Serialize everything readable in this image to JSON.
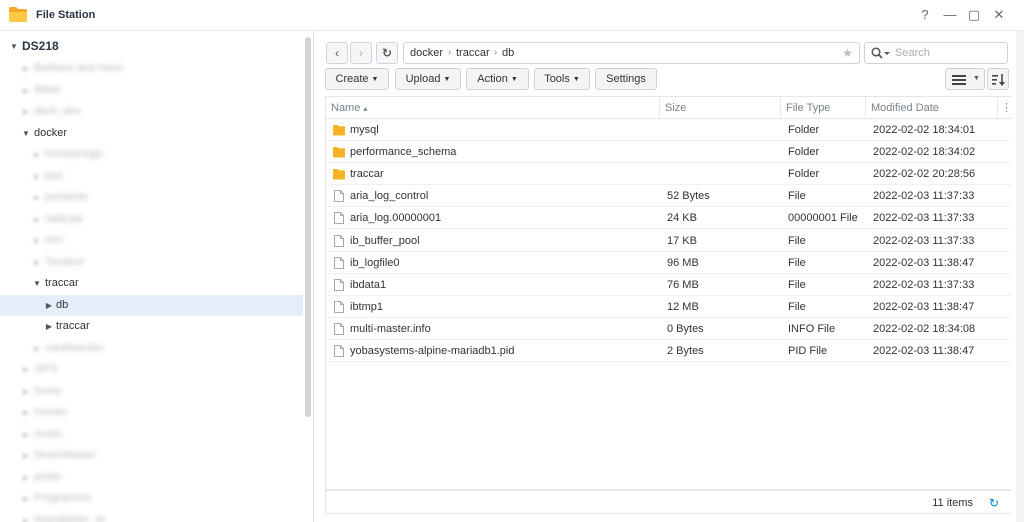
{
  "window": {
    "title": "File Station",
    "help_glyph": "?",
    "minimize_glyph": "—",
    "maximize_glyph": "▢",
    "close_glyph": "✕"
  },
  "tree": {
    "root": "DS218",
    "items": [
      {
        "label": "Barbara and Hans",
        "level": 1,
        "expanded": false,
        "blurred": true
      },
      {
        "label": "Bilder",
        "level": 1,
        "expanded": false,
        "blurred": true
      },
      {
        "label": "deck_dev",
        "level": 1,
        "expanded": false,
        "blurred": true
      },
      {
        "label": "docker",
        "level": 1,
        "expanded": true,
        "blurred": false
      },
      {
        "label": "homebridge",
        "level": 2,
        "expanded": false,
        "blurred": true
      },
      {
        "label": "test",
        "level": 2,
        "expanded": false,
        "blurred": true
      },
      {
        "label": "portainer",
        "level": 2,
        "expanded": false,
        "blurred": true
      },
      {
        "label": "radicale",
        "level": 2,
        "expanded": false,
        "blurred": true
      },
      {
        "label": "cert",
        "level": 2,
        "expanded": false,
        "blurred": true
      },
      {
        "label": "Tandoor",
        "level": 2,
        "expanded": false,
        "blurred": true
      },
      {
        "label": "traccar",
        "level": 2,
        "expanded": true,
        "blurred": false
      },
      {
        "label": "db",
        "level": 3,
        "expanded": false,
        "blurred": false,
        "selected": true
      },
      {
        "label": "traccar",
        "level": 3,
        "expanded": false,
        "blurred": false
      },
      {
        "label": "vaultwarden",
        "level": 2,
        "expanded": false,
        "blurred": true
      },
      {
        "label": "GPS",
        "level": 1,
        "expanded": false,
        "blurred": true
      },
      {
        "label": "home",
        "level": 1,
        "expanded": false,
        "blurred": true
      },
      {
        "label": "homes",
        "level": 1,
        "expanded": false,
        "blurred": true
      },
      {
        "label": "music",
        "level": 1,
        "expanded": false,
        "blurred": true
      },
      {
        "label": "MusicMaster",
        "level": 1,
        "expanded": false,
        "blurred": true
      },
      {
        "label": "photo",
        "level": 1,
        "expanded": false,
        "blurred": true
      },
      {
        "label": "Programme",
        "level": 1,
        "expanded": false,
        "blurred": true
      },
      {
        "label": "Wandbilder_M",
        "level": 1,
        "expanded": false,
        "blurred": true
      }
    ]
  },
  "nav": {
    "back_glyph": "‹",
    "forward_glyph": "›",
    "refresh_glyph": "↻",
    "breadcrumbs": [
      "docker",
      "traccar",
      "db"
    ],
    "separator": "›",
    "star_glyph": "★",
    "search_placeholder": "Search"
  },
  "toolbar": {
    "create": "Create",
    "upload": "Upload",
    "action": "Action",
    "tools": "Tools",
    "settings": "Settings",
    "caret": "▼"
  },
  "columns": {
    "name": "Name",
    "name_sort_glyph": "▴",
    "size": "Size",
    "type": "File Type",
    "modified": "Modified Date",
    "menu_glyph": "⋮"
  },
  "files": [
    {
      "name": "mysql",
      "size": "",
      "type": "Folder",
      "modified": "2022-02-02 18:34:01",
      "kind": "folder"
    },
    {
      "name": "performance_schema",
      "size": "",
      "type": "Folder",
      "modified": "2022-02-02 18:34:02",
      "kind": "folder"
    },
    {
      "name": "traccar",
      "size": "",
      "type": "Folder",
      "modified": "2022-02-02 20:28:56",
      "kind": "folder"
    },
    {
      "name": "aria_log_control",
      "size": "52 Bytes",
      "type": "File",
      "modified": "2022-02-03 11:37:33",
      "kind": "file"
    },
    {
      "name": "aria_log.00000001",
      "size": "24 KB",
      "type": "00000001 File",
      "modified": "2022-02-03 11:37:33",
      "kind": "file"
    },
    {
      "name": "ib_buffer_pool",
      "size": "17 KB",
      "type": "File",
      "modified": "2022-02-03 11:37:33",
      "kind": "file"
    },
    {
      "name": "ib_logfile0",
      "size": "96 MB",
      "type": "File",
      "modified": "2022-02-03 11:38:47",
      "kind": "file"
    },
    {
      "name": "ibdata1",
      "size": "76 MB",
      "type": "File",
      "modified": "2022-02-03 11:37:33",
      "kind": "file"
    },
    {
      "name": "ibtmp1",
      "size": "12 MB",
      "type": "File",
      "modified": "2022-02-03 11:38:47",
      "kind": "file"
    },
    {
      "name": "multi-master.info",
      "size": "0 Bytes",
      "type": "INFO File",
      "modified": "2022-02-02 18:34:08",
      "kind": "file"
    },
    {
      "name": "yobasystems-alpine-mariadb1.pid",
      "size": "2 Bytes",
      "type": "PID File",
      "modified": "2022-02-03 11:38:47",
      "kind": "file"
    }
  ],
  "status": {
    "count": "11 items",
    "refresh_glyph": "↻"
  },
  "colors": {
    "folder": "#f5b323",
    "accent": "#0086e5",
    "selected": "#e3eefa"
  }
}
